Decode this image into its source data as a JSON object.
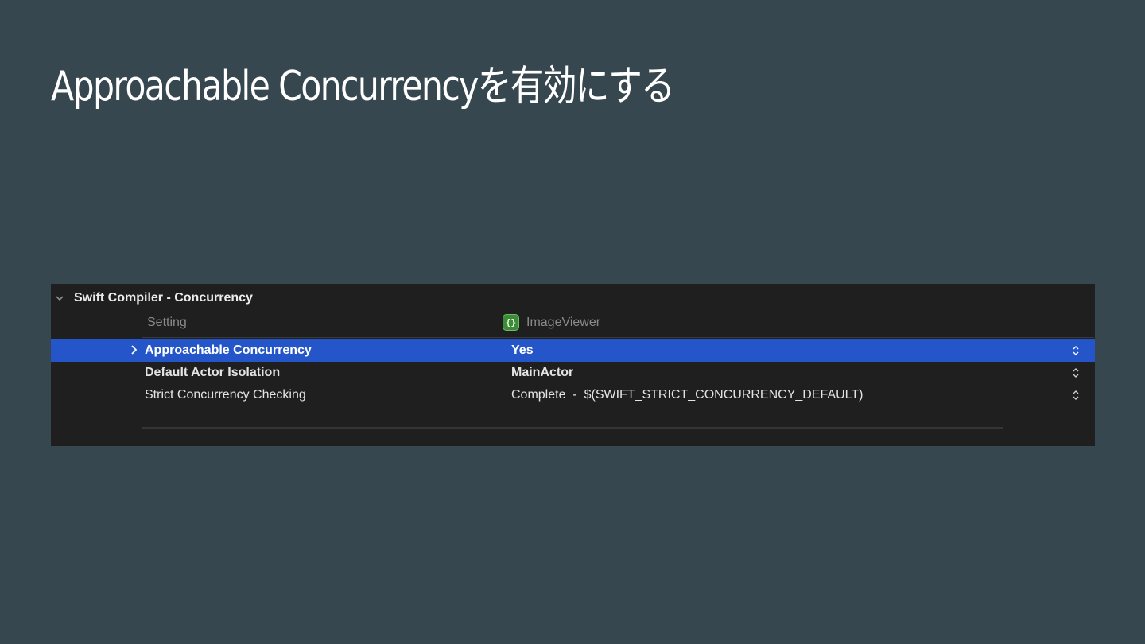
{
  "slide": {
    "title": "Approachable Concurrencyを有効にする"
  },
  "panel": {
    "section_title": "Swift Compiler - Concurrency",
    "columns": {
      "setting": "Setting",
      "target": "ImageViewer",
      "target_icon": "swift-target-icon"
    },
    "rows": [
      {
        "name": "Approachable Concurrency",
        "value": "Yes",
        "selected": true,
        "bold": true
      },
      {
        "name": "Default Actor Isolation",
        "value": "MainActor",
        "selected": false,
        "bold": true
      },
      {
        "name": "Strict Concurrency Checking",
        "value": "Complete  -  $(SWIFT_STRICT_CONCURRENCY_DEFAULT)",
        "selected": false,
        "bold": false
      }
    ]
  },
  "colors": {
    "background": "#37474f",
    "panel": "#1f1f1f",
    "selection": "#2556c9",
    "target_icon": "#3c8a3a"
  }
}
